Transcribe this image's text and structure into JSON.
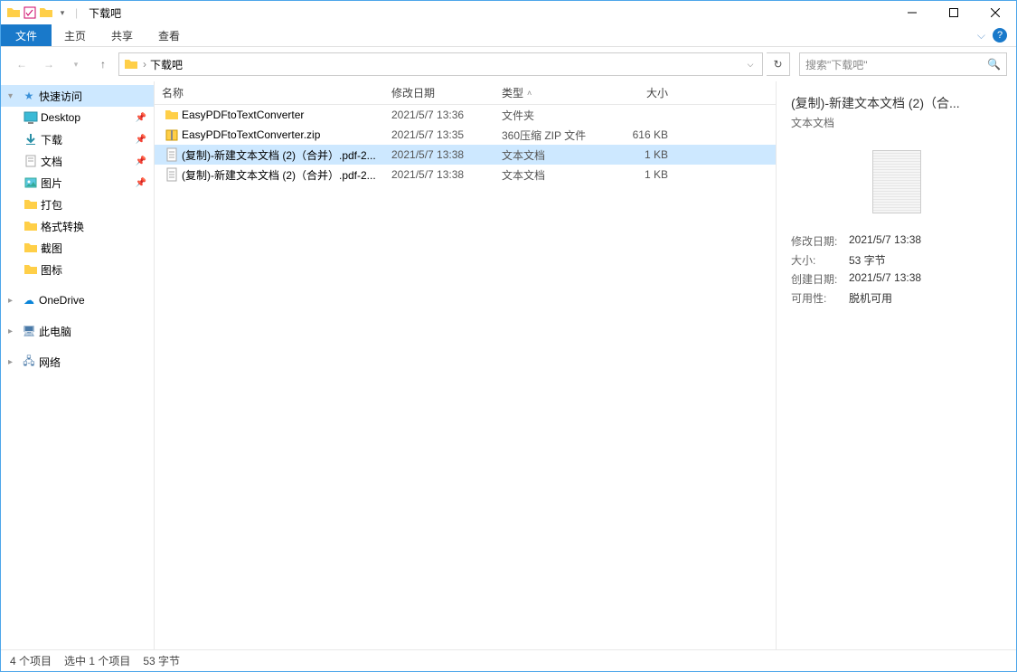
{
  "window": {
    "title": "下载吧"
  },
  "ribbon": {
    "file": "文件",
    "home": "主页",
    "share": "共享",
    "view": "查看"
  },
  "address": {
    "folder": "下载吧",
    "sep": "›"
  },
  "search": {
    "placeholder": "搜索\"下载吧\""
  },
  "nav": {
    "quickaccess": "快速访问",
    "items": [
      {
        "label": "Desktop",
        "pin": true
      },
      {
        "label": "下载",
        "pin": true
      },
      {
        "label": "文档",
        "pin": true
      },
      {
        "label": "图片",
        "pin": true
      },
      {
        "label": "打包",
        "pin": false
      },
      {
        "label": "格式转换",
        "pin": false
      },
      {
        "label": "截图",
        "pin": false
      },
      {
        "label": "图标",
        "pin": false
      }
    ],
    "onedrive": "OneDrive",
    "thispc": "此电脑",
    "network": "网络"
  },
  "columns": {
    "name": "名称",
    "date": "修改日期",
    "type": "类型",
    "size": "大小"
  },
  "files": [
    {
      "name": "EasyPDFtoTextConverter",
      "date": "2021/5/7 13:36",
      "type": "文件夹",
      "size": "",
      "icon": "folder"
    },
    {
      "name": "EasyPDFtoTextConverter.zip",
      "date": "2021/5/7 13:35",
      "type": "360压缩 ZIP 文件",
      "size": "616 KB",
      "icon": "zip"
    },
    {
      "name": "(复制)-新建文本文档 (2)（合并）.pdf-2...",
      "date": "2021/5/7 13:38",
      "type": "文本文档",
      "size": "1 KB",
      "icon": "txt",
      "selected": true
    },
    {
      "name": "(复制)-新建文本文档 (2)（合并）.pdf-2...",
      "date": "2021/5/7 13:38",
      "type": "文本文档",
      "size": "1 KB",
      "icon": "txt"
    }
  ],
  "preview": {
    "title": "(复制)-新建文本文档 (2)（合...",
    "subtitle": "文本文档",
    "meta": {
      "modified_k": "修改日期:",
      "modified_v": "2021/5/7 13:38",
      "size_k": "大小:",
      "size_v": "53 字节",
      "created_k": "创建日期:",
      "created_v": "2021/5/7 13:38",
      "avail_k": "可用性:",
      "avail_v": "脱机可用"
    }
  },
  "status": {
    "count": "4 个项目",
    "sel": "选中 1 个项目",
    "bytes": "53 字节"
  }
}
